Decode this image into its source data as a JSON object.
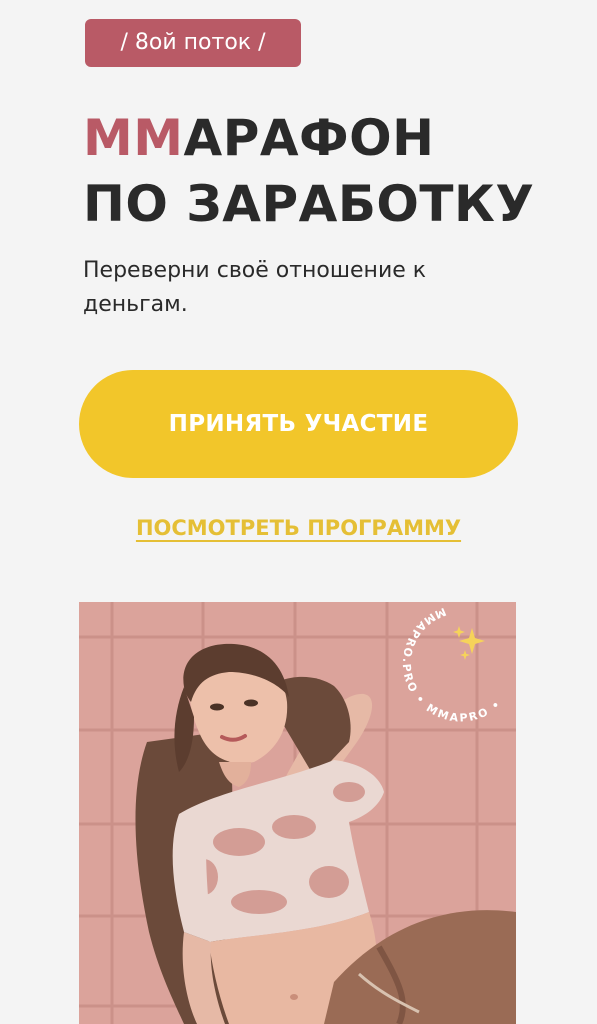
{
  "hero": {
    "badge": "/ 8ой поток /",
    "title_accent": "ММ",
    "title_line1_rest": "АРАФОН",
    "title_line2": "ПО ЗАРАБОТКУ",
    "subtitle": "Переверни своё отношение к деньгам.",
    "cta_label": "ПРИНЯТЬ УЧАСТИЕ",
    "program_link": "ПОСМОТРЕТЬ ПРОГРАММУ"
  },
  "photo": {
    "watermark": "MMAPRO.PRO • MMAPRO •"
  },
  "colors": {
    "accent": "#b95a66",
    "cta": "#f2c62a",
    "link": "#e5bf35",
    "text": "#2a2a2a",
    "background": "#f4f4f4"
  }
}
